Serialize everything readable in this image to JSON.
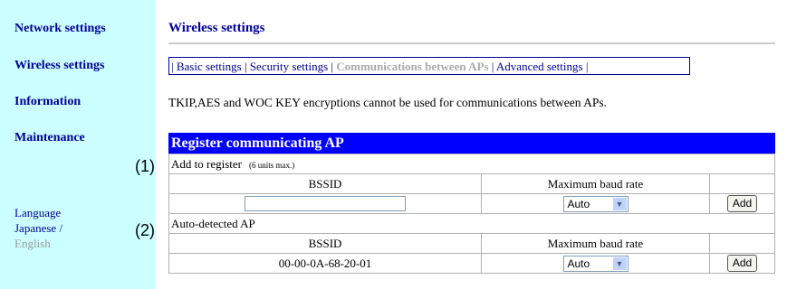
{
  "sidebar": {
    "items": [
      {
        "label": "Network settings"
      },
      {
        "label": "Wireless settings"
      },
      {
        "label": "Information"
      },
      {
        "label": "Maintenance"
      }
    ],
    "callouts": [
      "(1)",
      "(2)"
    ],
    "language": {
      "title": "Language",
      "japanese": "Japanese",
      "separator": " /",
      "english": "English"
    }
  },
  "main": {
    "title": "Wireless settings",
    "tabs": [
      {
        "label": "Basic settings"
      },
      {
        "label": "Security settings"
      },
      {
        "label": "Communications between APs"
      },
      {
        "label": "Advanced settings"
      }
    ],
    "notice": "TKIP,AES and WOC KEY encryptions cannot be used for communications between APs.",
    "register": {
      "header": "Register communicating AP",
      "add_section": "Add to register",
      "add_note": "(6 units max.)",
      "col_bssid": "BSSID",
      "col_rate": "Maximum baud rate",
      "bssid_value": "",
      "rate_value": "Auto",
      "add_label": "Add"
    },
    "auto": {
      "section": "Auto-detected AP",
      "col_bssid": "BSSID",
      "col_rate": "Maximum baud rate",
      "rows": [
        {
          "bssid": "00-00-0A-68-20-01",
          "rate": "Auto",
          "add_label": "Add"
        }
      ]
    }
  }
}
